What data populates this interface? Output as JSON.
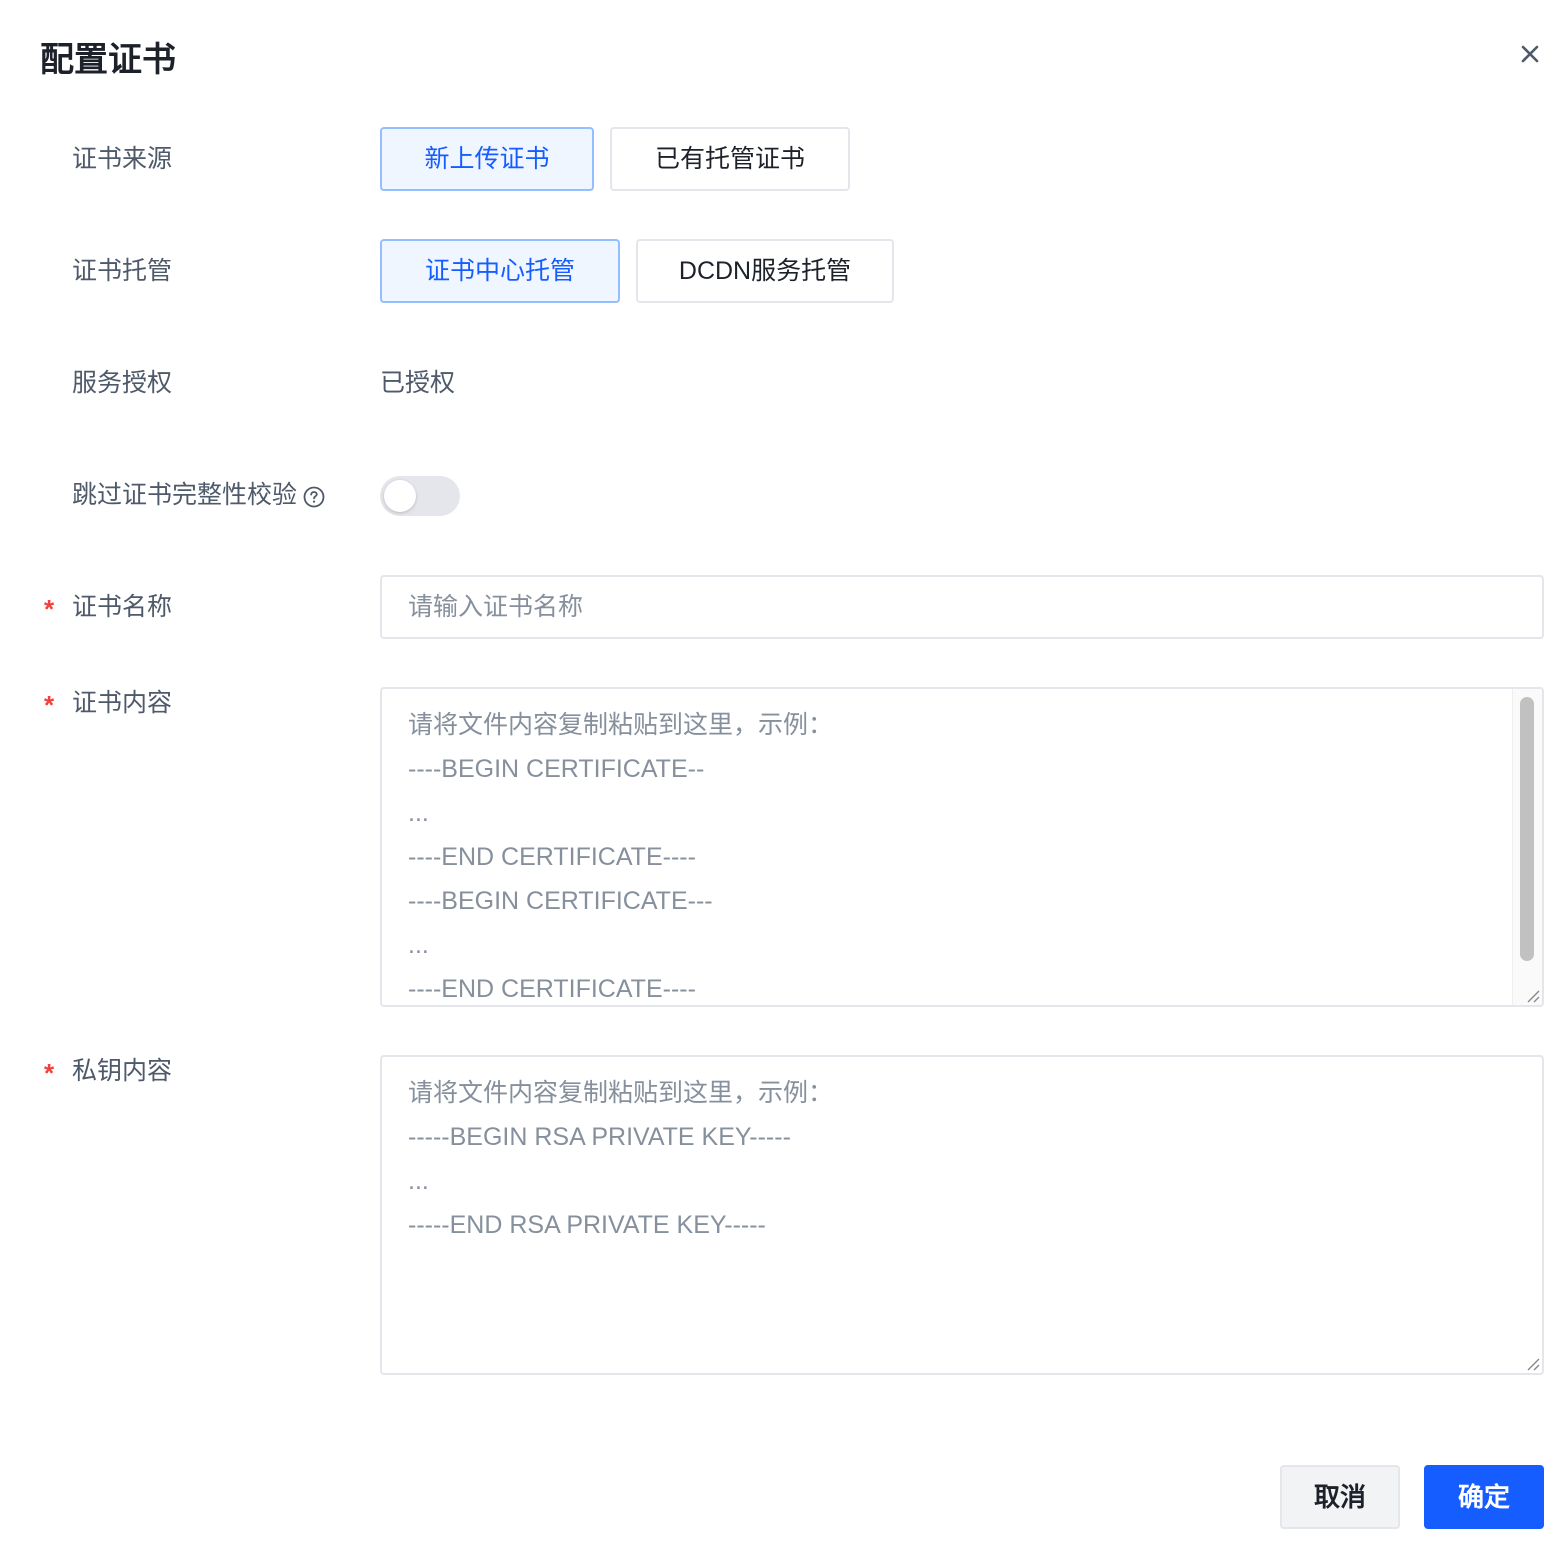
{
  "dialog": {
    "title": "配置证书",
    "close_icon": "close-icon"
  },
  "form": {
    "cert_source": {
      "label": "证书来源",
      "options": [
        "新上传证书",
        "已有托管证书"
      ],
      "selected": "新上传证书"
    },
    "cert_hosting": {
      "label": "证书托管",
      "options": [
        "证书中心托管",
        "DCDN服务托管"
      ],
      "selected": "证书中心托管"
    },
    "service_auth": {
      "label": "服务授权",
      "value": "已授权"
    },
    "skip_check": {
      "label": "跳过证书完整性校验",
      "help_icon": "question-circle-icon",
      "enabled": false
    },
    "cert_name": {
      "required_mark": "*",
      "label": "证书名称",
      "placeholder": "请输入证书名称"
    },
    "cert_content": {
      "required_mark": "*",
      "label": "证书内容",
      "placeholder_lines": [
        "请将文件内容复制粘贴到这里，示例：",
        "----BEGIN CERTIFICATE--",
        "...",
        "----END CERTIFICATE----",
        "----BEGIN CERTIFICATE---",
        "...",
        "----END CERTIFICATE----"
      ]
    },
    "private_key": {
      "required_mark": "*",
      "label": "私钥内容",
      "placeholder_lines": [
        "请将文件内容复制粘贴到这里，示例：",
        "-----BEGIN RSA PRIVATE KEY-----",
        "...",
        "-----END RSA PRIVATE KEY-----"
      ]
    }
  },
  "footer": {
    "cancel_label": "取消",
    "confirm_label": "确定"
  },
  "colors": {
    "primary": "#165dff",
    "required": "#f53f3f",
    "border": "#e5e6eb"
  }
}
